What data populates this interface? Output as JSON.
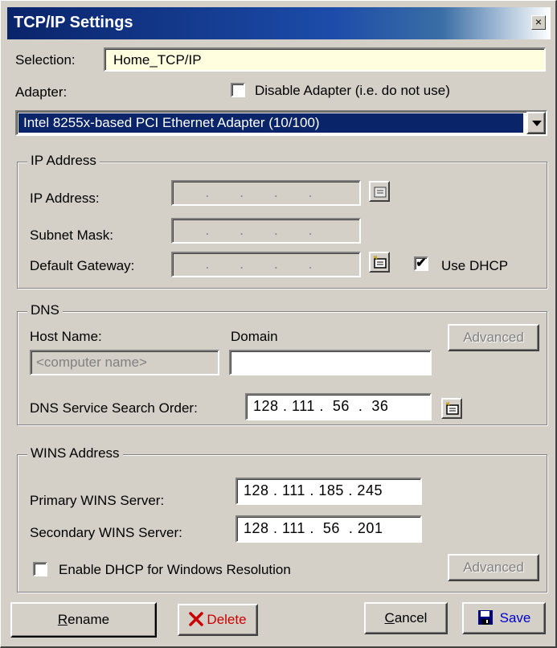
{
  "window": {
    "title": "TCP/IP Settings",
    "close_glyph": "×"
  },
  "selection": {
    "label": "Selection:",
    "value": "Home_TCP/IP"
  },
  "adapter": {
    "label": "Adapter:",
    "disable_label": "Disable Adapter (i.e. do not use)",
    "disable_checked": false,
    "selected": "Intel 8255x-based PCI Ethernet Adapter (10/100)"
  },
  "ip_group": {
    "title": "IP Address",
    "ip_label": "IP Address:",
    "subnet_label": "Subnet Mask:",
    "gateway_label": "Default Gateway:",
    "use_dhcp_label": "Use DHCP",
    "use_dhcp_checked": true,
    "check_glyph": "✔"
  },
  "dns_group": {
    "title": "DNS",
    "host_label": "Host Name:",
    "host_placeholder": "<computer name>",
    "domain_label": "Domain",
    "domain_value": "",
    "advanced_label": "Advanced",
    "search_order_label": "DNS Service Search Order:",
    "search_order_value": "128 . 111 .  56  .  36"
  },
  "wins_group": {
    "title": "WINS Address",
    "primary_label": "Primary WINS Server:",
    "primary_value": "128 . 111 . 185 . 245",
    "secondary_label": "Secondary WINS Server:",
    "secondary_value": "128 . 111 .  56  . 201",
    "dhcp_label": "Enable DHCP for Windows Resolution",
    "dhcp_checked": false,
    "advanced_label": "Advanced"
  },
  "buttons": {
    "rename_first": "R",
    "rename_rest": "ename",
    "delete": "Delete",
    "cancel_first": "C",
    "cancel_rest": "ancel",
    "save": "Save"
  },
  "colors": {
    "title_bar": "#0a246a",
    "delete_x": "#cc0000",
    "save_text": "#0000cc",
    "selection_bg": "#0a246a"
  },
  "icons": [
    "close-icon",
    "dropdown-arrow-icon",
    "ip-list-icon",
    "delete-x-icon",
    "floppy-disk-icon"
  ]
}
